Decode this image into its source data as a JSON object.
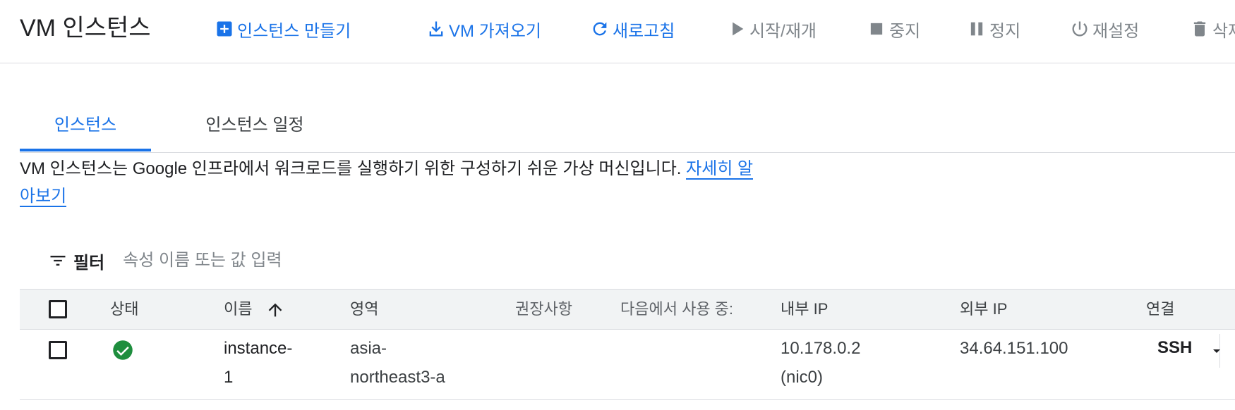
{
  "header": {
    "title": "VM 인스턴스",
    "actions": [
      {
        "label": "인스턴스 만들기",
        "icon": "add-box-icon",
        "state": "enabled"
      },
      {
        "label": "VM 가져오기",
        "icon": "download-icon",
        "state": "enabled"
      },
      {
        "label": "새로고침",
        "icon": "refresh-icon",
        "state": "enabled"
      },
      {
        "label": "시작/재개",
        "icon": "play-icon",
        "state": "disabled"
      },
      {
        "label": "중지",
        "icon": "stop-icon",
        "state": "disabled"
      },
      {
        "label": "정지",
        "icon": "pause-icon",
        "state": "disabled"
      },
      {
        "label": "재설정",
        "icon": "power-icon",
        "state": "disabled"
      },
      {
        "label": "삭제",
        "icon": "trash-icon",
        "state": "disabled"
      }
    ]
  },
  "tabs": [
    {
      "label": "인스턴스",
      "active": true
    },
    {
      "label": "인스턴스 일정",
      "active": false
    }
  ],
  "description": {
    "text": "VM 인스턴스는 Google 인프라에서 워크로드를 실행하기 위한 구성하기 쉬운 가상 머신입니다. ",
    "link": "자세히 알아보기"
  },
  "filter": {
    "icon": "filter-list-icon",
    "label": "필터",
    "placeholder": "속성 이름 또는 값 입력"
  },
  "table": {
    "columns": {
      "status": "상태",
      "name": "이름",
      "zone": "영역",
      "recommendation": "권장사항",
      "in_use_by": "다음에서 사용 중:",
      "internal_ip": "내부 IP",
      "external_ip": "외부 IP",
      "connect": "연결"
    },
    "sort": {
      "column": "name",
      "direction": "ascending",
      "icon": "arrow-upward-icon"
    },
    "rows": [
      {
        "status": "running",
        "status_icon": "check-circle-icon",
        "name": [
          "instance-",
          "1"
        ],
        "zone": [
          "asia-",
          "northeast3-a"
        ],
        "recommendation": "",
        "in_use_by": "",
        "internal_ip": [
          "10.178.0.2",
          "(nic0)"
        ],
        "external_ip": "34.64.151.100",
        "connect": "SSH"
      }
    ]
  },
  "colors": {
    "accent": "#1a73e8",
    "disabled": "#80868b",
    "status_ok": "#1e8e3e",
    "header_bg": "#f1f3f4"
  }
}
